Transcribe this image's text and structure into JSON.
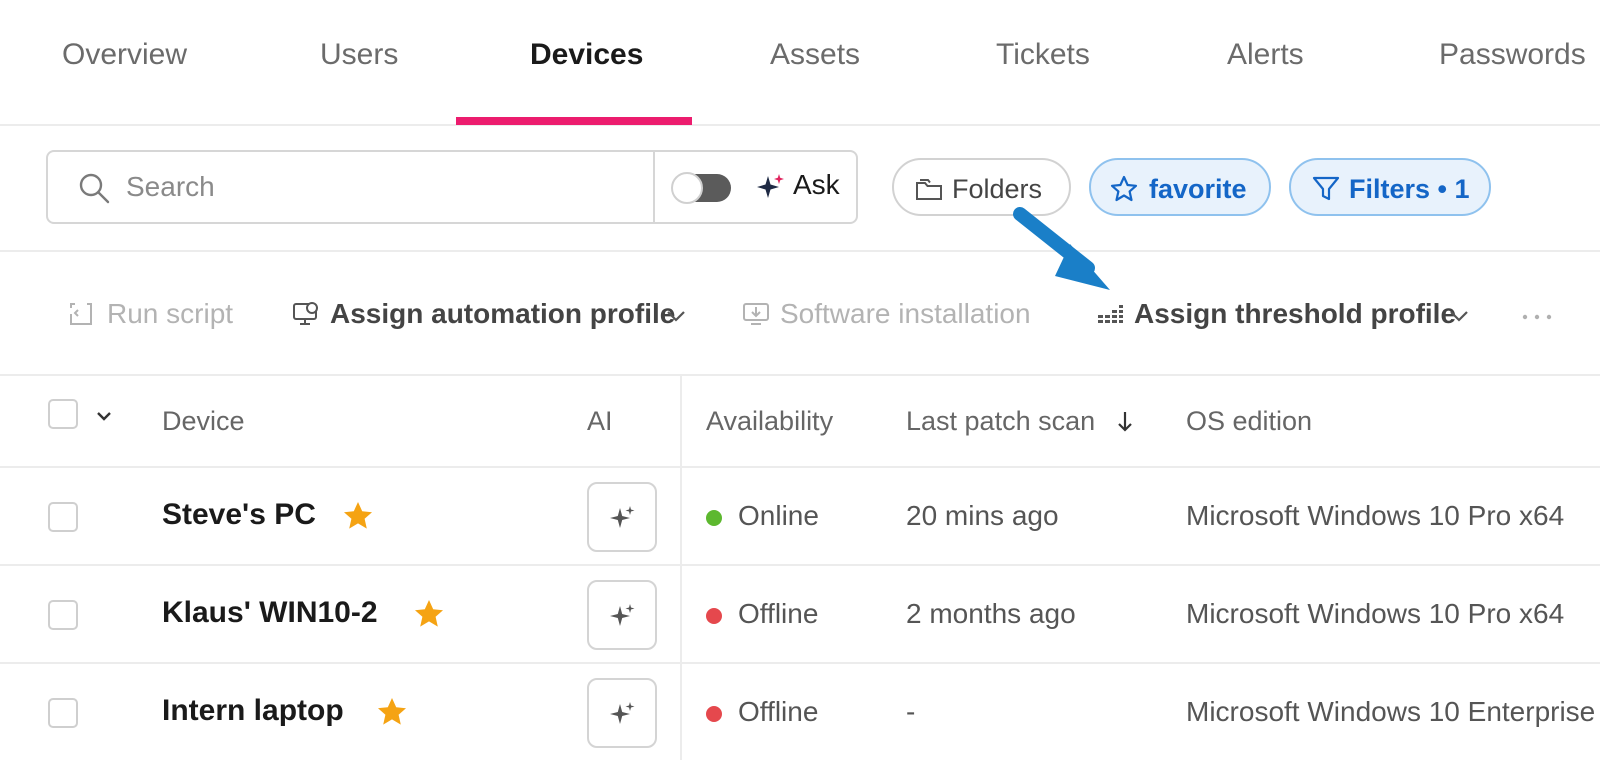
{
  "tabs": {
    "overview": "Overview",
    "users": "Users",
    "devices": "Devices",
    "assets": "Assets",
    "tickets": "Tickets",
    "alerts": "Alerts",
    "passwords": "Passwords",
    "active": "Devices"
  },
  "search": {
    "placeholder": "Search",
    "ask_label": "Ask",
    "ask_toggle_on": false
  },
  "pills": {
    "folders": "Folders",
    "favorite": "favorite",
    "filters": "Filters • 1"
  },
  "actions": {
    "run_script": "Run script",
    "assign_automation": "Assign automation profile",
    "software_installation": "Software installation",
    "assign_threshold": "Assign threshold profile",
    "more_icon": "more-horizontal-icon"
  },
  "table": {
    "headers": {
      "device": "Device",
      "ai": "AI",
      "availability": "Availability",
      "last_patch_scan": "Last patch scan",
      "os_edition": "OS edition"
    },
    "sort": {
      "column": "Last patch scan",
      "direction": "descending"
    },
    "rows": [
      {
        "device": "Steve's PC",
        "favorite": true,
        "availability": "Online",
        "status_color": "#5db82f",
        "last_patch_scan": "20 mins ago",
        "os_edition": "Microsoft Windows 10 Pro x64"
      },
      {
        "device": "Klaus' WIN10-2",
        "favorite": true,
        "availability": "Offline",
        "status_color": "#e5484d",
        "last_patch_scan": "2 months ago",
        "os_edition": "Microsoft Windows 10 Pro x64"
      },
      {
        "device": "Intern laptop",
        "favorite": true,
        "availability": "Offline",
        "status_color": "#e5484d",
        "last_patch_scan": "-",
        "os_edition": "Microsoft Windows 10 Enterprise"
      }
    ]
  },
  "colors": {
    "accent": "#ec1c6e",
    "pill_active_bg": "#e8f2fc",
    "pill_active_text": "#1466c7",
    "star": "#f5a313",
    "arrow": "#1a7fc8"
  }
}
